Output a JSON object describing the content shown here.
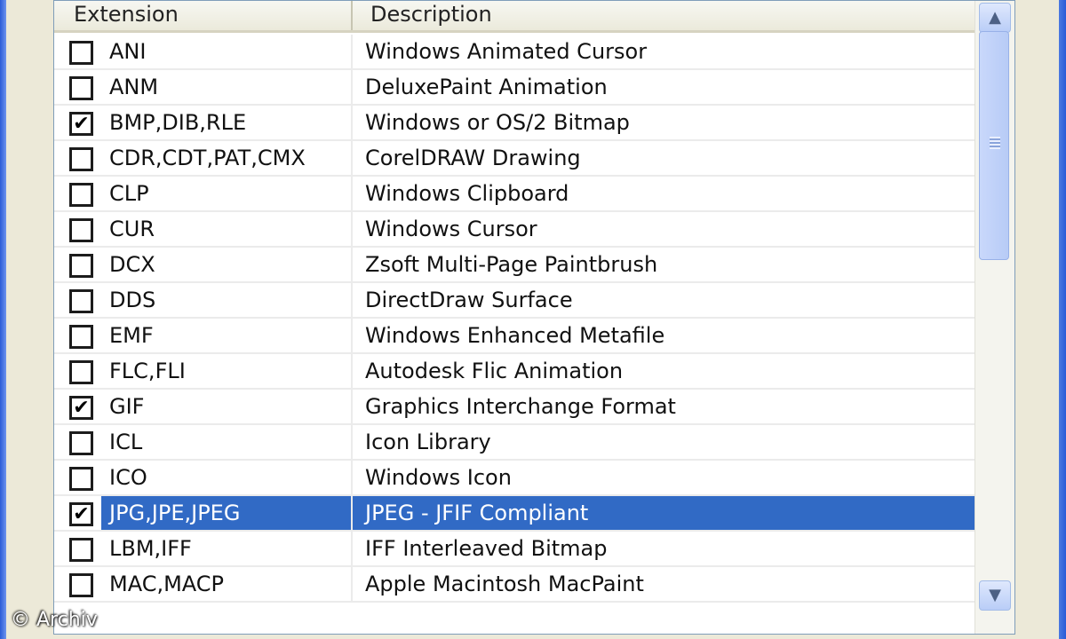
{
  "columns": {
    "extension": "Extension",
    "description": "Description"
  },
  "rows": [
    {
      "checked": false,
      "extension": "ANI",
      "description": "Windows Animated Cursor"
    },
    {
      "checked": false,
      "extension": "ANM",
      "description": "DeluxePaint Animation"
    },
    {
      "checked": true,
      "extension": "BMP,DIB,RLE",
      "description": "Windows or OS/2 Bitmap"
    },
    {
      "checked": false,
      "extension": "CDR,CDT,PAT,CMX",
      "description": "CorelDRAW Drawing"
    },
    {
      "checked": false,
      "extension": "CLP",
      "description": "Windows Clipboard"
    },
    {
      "checked": false,
      "extension": "CUR",
      "description": "Windows Cursor"
    },
    {
      "checked": false,
      "extension": "DCX",
      "description": "Zsoft Multi-Page Paintbrush"
    },
    {
      "checked": false,
      "extension": "DDS",
      "description": "DirectDraw Surface"
    },
    {
      "checked": false,
      "extension": "EMF",
      "description": "Windows Enhanced Metafile"
    },
    {
      "checked": false,
      "extension": "FLC,FLI",
      "description": "Autodesk Flic Animation"
    },
    {
      "checked": true,
      "extension": "GIF",
      "description": "Graphics Interchange Format"
    },
    {
      "checked": false,
      "extension": "ICL",
      "description": "Icon Library"
    },
    {
      "checked": false,
      "extension": "ICO",
      "description": "Windows Icon"
    },
    {
      "checked": true,
      "extension": "JPG,JPE,JPEG",
      "description": "JPEG - JFIF Compliant",
      "selected": true
    },
    {
      "checked": false,
      "extension": "LBM,IFF",
      "description": "IFF Interleaved Bitmap"
    },
    {
      "checked": false,
      "extension": "MAC,MACP",
      "description": "Apple Macintosh MacPaint"
    }
  ],
  "scrollbar": {
    "up_icon": "scroll-up-arrow",
    "down_icon": "scroll-down-arrow"
  },
  "watermark": "© Archiv",
  "colors": {
    "selection": "#316ac5",
    "window_frame": "#2a5bd7"
  }
}
